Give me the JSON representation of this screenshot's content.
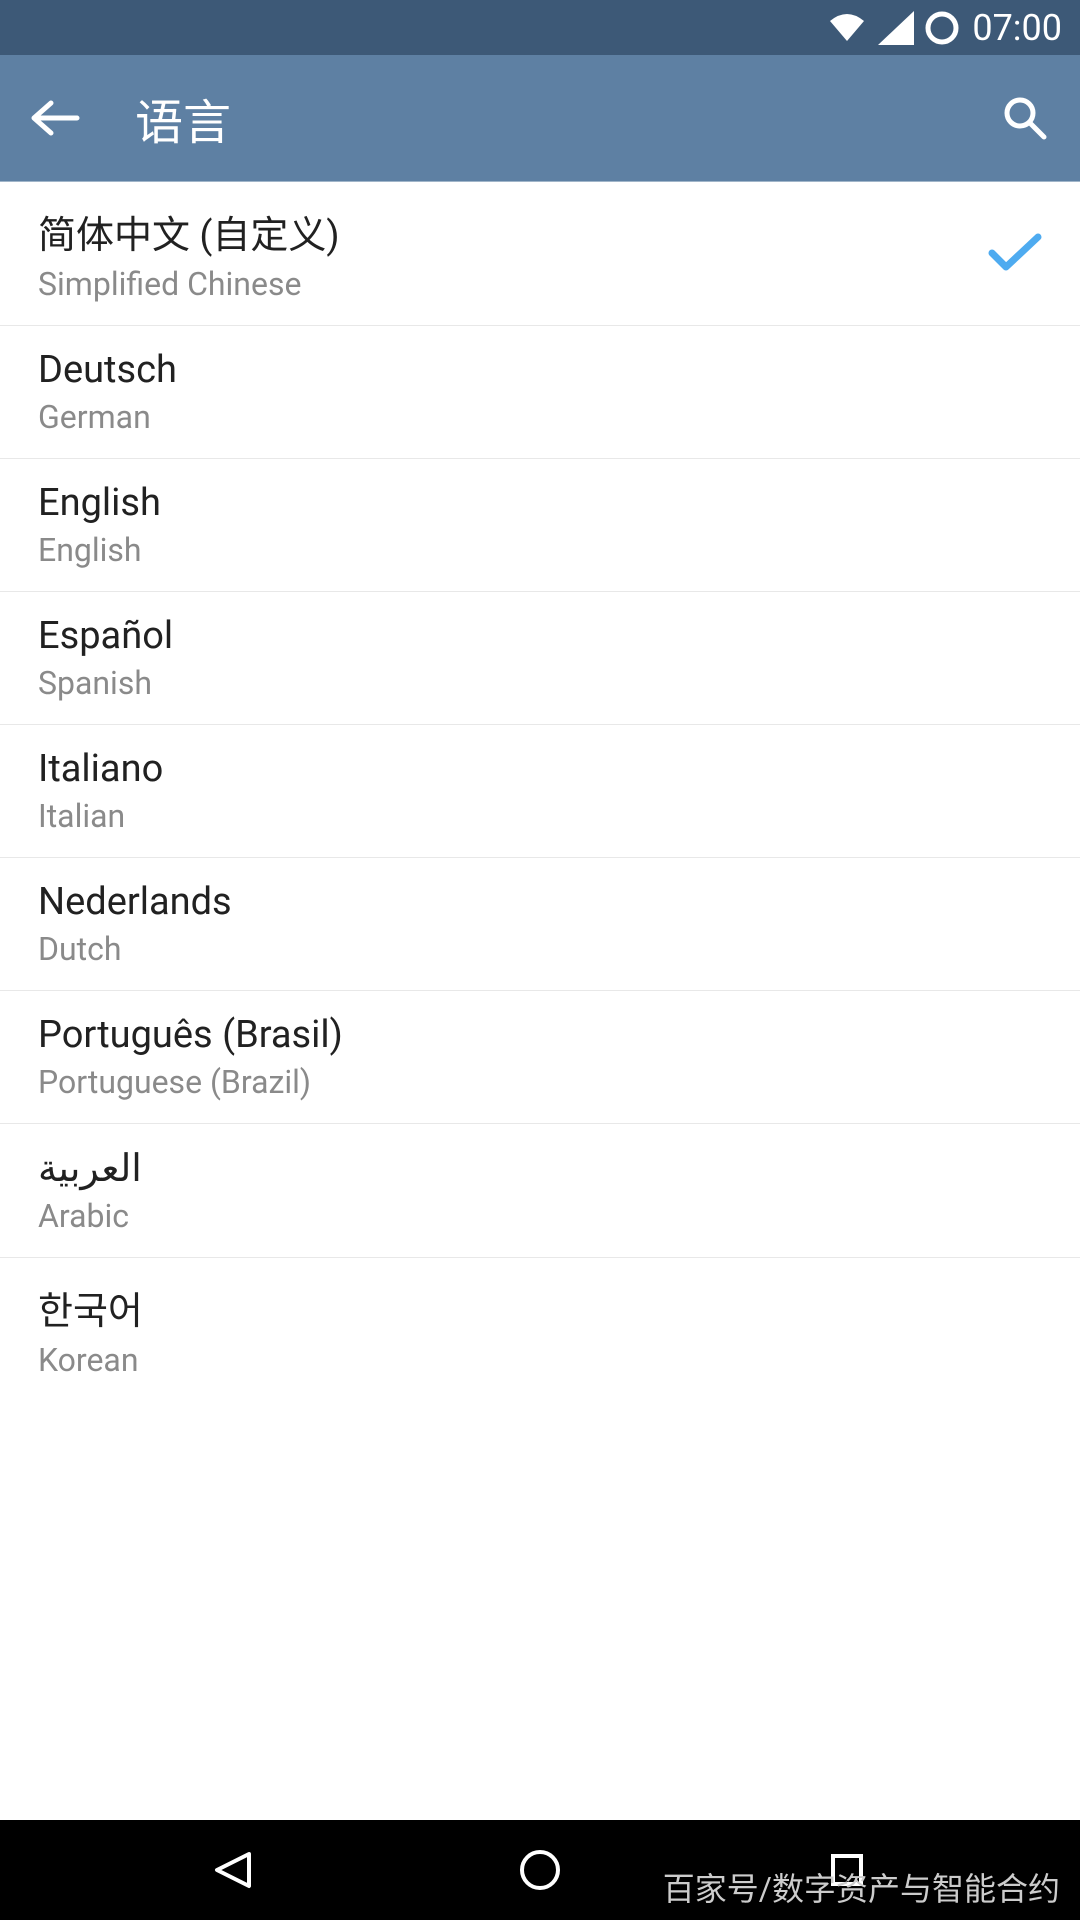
{
  "status_bar": {
    "time": "07:00"
  },
  "app_bar": {
    "title": "语言"
  },
  "languages": [
    {
      "native": "简体中文 (自定义)",
      "english": "Simplified Chinese",
      "selected": true
    },
    {
      "native": "Deutsch",
      "english": "German",
      "selected": false
    },
    {
      "native": "English",
      "english": "English",
      "selected": false
    },
    {
      "native": "Español",
      "english": "Spanish",
      "selected": false
    },
    {
      "native": "Italiano",
      "english": "Italian",
      "selected": false
    },
    {
      "native": "Nederlands",
      "english": "Dutch",
      "selected": false
    },
    {
      "native": "Português (Brasil)",
      "english": "Portuguese (Brazil)",
      "selected": false
    },
    {
      "native": "العربية",
      "english": "Arabic",
      "selected": false
    },
    {
      "native": "한국어",
      "english": "Korean",
      "selected": false
    }
  ],
  "watermark": "百家号/数字资产与智能合约"
}
